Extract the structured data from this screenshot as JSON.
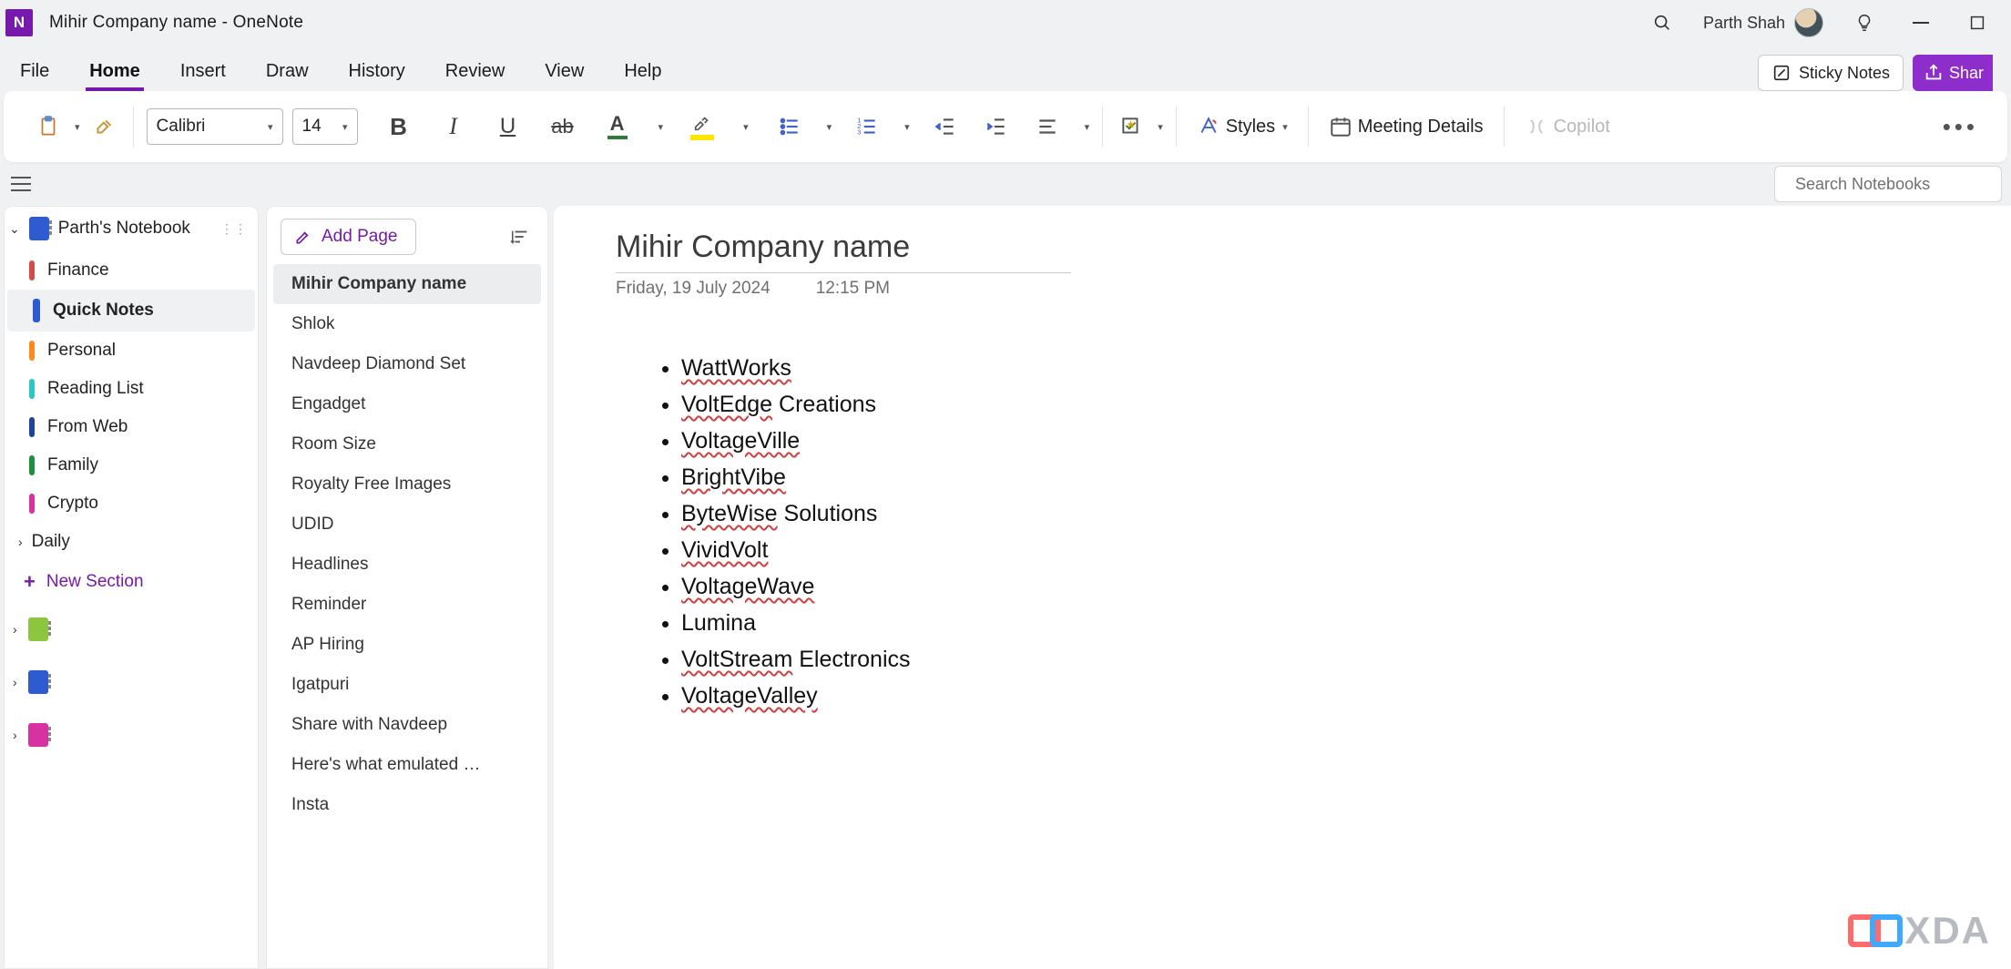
{
  "titlebar": {
    "title": "Mihir Company name  -  OneNote",
    "user": "Parth Shah"
  },
  "menu": {
    "items": [
      "File",
      "Home",
      "Insert",
      "Draw",
      "History",
      "Review",
      "View",
      "Help"
    ],
    "active": "Home",
    "sticky_notes": "Sticky Notes",
    "share": "Shar"
  },
  "ribbon": {
    "font_name": "Calibri",
    "font_size": "14",
    "styles": "Styles",
    "meeting": "Meeting Details",
    "copilot": "Copilot"
  },
  "search": {
    "placeholder": "Search Notebooks"
  },
  "notebook": {
    "name": "Parth's Notebook",
    "sections": [
      {
        "label": "Finance",
        "color": "c-red"
      },
      {
        "label": "Quick Notes",
        "color": "c-navy",
        "current": true
      },
      {
        "label": "Personal",
        "color": "c-orange"
      },
      {
        "label": "Reading List",
        "color": "c-teal"
      },
      {
        "label": "From Web",
        "color": "c-dblue"
      },
      {
        "label": "Family",
        "color": "c-green"
      },
      {
        "label": "Crypto",
        "color": "c-mag"
      }
    ],
    "group": "Daily",
    "new_section": "New Section"
  },
  "pages": {
    "add_label": "Add Page",
    "items": [
      "Mihir Company name",
      "Shlok",
      "Navdeep Diamond Set",
      "Engadget",
      "Room Size",
      "Royalty Free Images",
      "UDID",
      "Headlines",
      "Reminder",
      "AP Hiring",
      "Igatpuri",
      "Share with Navdeep",
      "Here's what emulated …",
      "Insta"
    ],
    "current": 0
  },
  "note": {
    "title": "Mihir Company name",
    "date": "Friday, 19 July 2024",
    "time": "12:15 PM",
    "items": [
      {
        "err": "WattWorks",
        "rest": ""
      },
      {
        "err": "VoltEdge",
        "rest": " Creations"
      },
      {
        "err": "VoltageVille",
        "rest": ""
      },
      {
        "err": "BrightVibe",
        "rest": ""
      },
      {
        "err": "ByteWise",
        "rest": " Solutions"
      },
      {
        "err": "VividVolt",
        "rest": ""
      },
      {
        "err": "VoltageWave",
        "rest": ""
      },
      {
        "err": "",
        "rest": "Lumina"
      },
      {
        "err": "VoltStream",
        "rest": " Electronics"
      },
      {
        "err": "VoltageValley",
        "rest": ""
      }
    ]
  },
  "watermark": "XDA"
}
